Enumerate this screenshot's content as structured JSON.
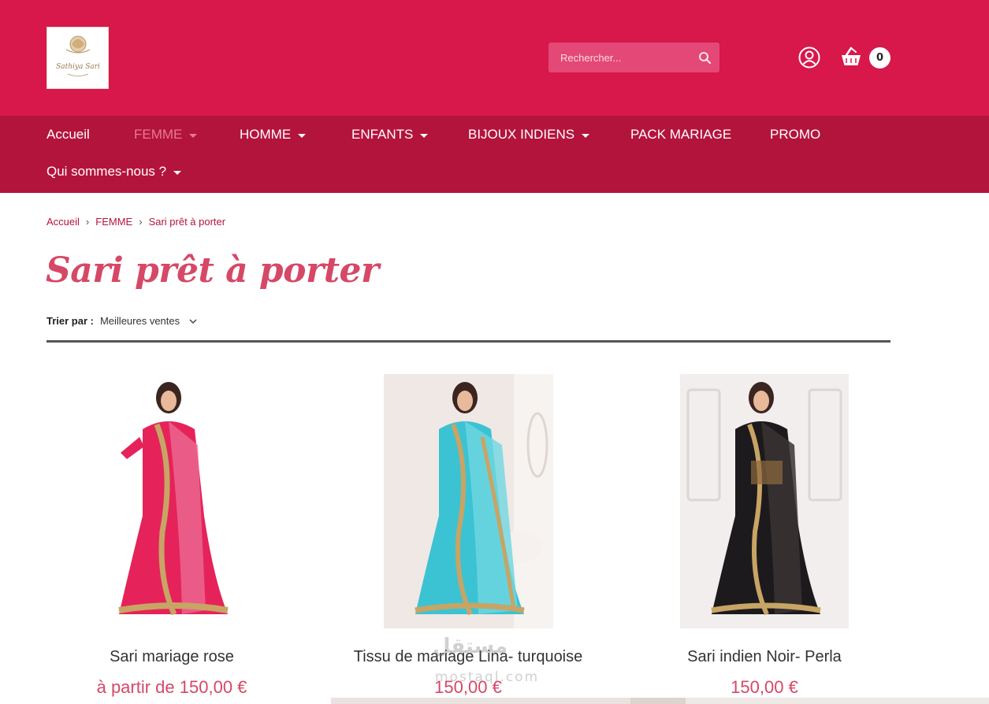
{
  "header": {
    "logo_text": "Sathiya Sari",
    "search": {
      "placeholder": "Rechercher..."
    },
    "cart_count": "0",
    "brand_color": "#d8174a",
    "nav_color": "#b3143c"
  },
  "nav": {
    "items": [
      {
        "label": "Accueil",
        "has_caret": false
      },
      {
        "label": "FEMME",
        "has_caret": true,
        "active": true
      },
      {
        "label": "HOMME",
        "has_caret": true
      },
      {
        "label": "ENFANTS",
        "has_caret": true
      },
      {
        "label": "BIJOUX INDIENS",
        "has_caret": true
      },
      {
        "label": "PACK MARIAGE",
        "has_caret": false
      },
      {
        "label": "PROMO",
        "has_caret": false
      },
      {
        "label": "Qui sommes-nous ?",
        "has_caret": true
      }
    ]
  },
  "breadcrumb": {
    "items": [
      "Accueil",
      "FEMME",
      "Sari prêt à porter"
    ]
  },
  "page": {
    "title": "Sari prêt à porter",
    "sort_label": "Trier par :",
    "sort_value": "Meilleures ventes"
  },
  "products": [
    {
      "name": "Sari mariage rose",
      "price": "à partir de 150,00 €",
      "color": "#e5235a",
      "accent": "#ec6f97"
    },
    {
      "name": "Tissu de mariage Lina- turquoise",
      "price": "150,00 €",
      "color": "#3cc3d3",
      "accent": "#6fd7e0"
    },
    {
      "name": "Sari indien Noir- Perla",
      "price": "150,00 €",
      "color": "#1c1a1c",
      "accent": "#3a3433"
    }
  ],
  "watermark": {
    "line1": "مستقل",
    "line2": "mostaql.com"
  }
}
